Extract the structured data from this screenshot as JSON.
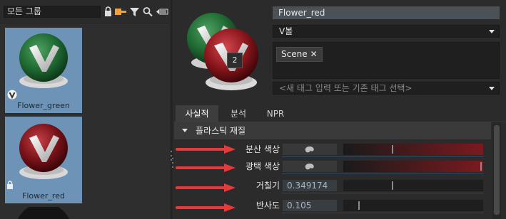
{
  "left": {
    "group_filter": "모든 그룹",
    "toolbar_icons": [
      "lock-icon",
      "tag-icon",
      "filter-icon",
      "search-icon",
      "size-slider-icon"
    ],
    "assets": [
      {
        "name": "Flower_green",
        "selected": true,
        "badge": "vector-icon"
      },
      {
        "name": "Flower_red",
        "selected": true,
        "badge": "lock-icon"
      }
    ]
  },
  "right": {
    "material_name": "Flower_red",
    "shader_select": "V볼",
    "preview_badge": "2",
    "tags": [
      {
        "label": "Scene",
        "remove": "✕"
      }
    ],
    "tag_input_placeholder": "<새 태그 입력 또는 기존 태그 선택>",
    "tabs": [
      {
        "label": "사실적",
        "active": true
      },
      {
        "label": "분석",
        "active": false
      },
      {
        "label": "NPR",
        "active": false
      }
    ],
    "section_title": "플라스틱 재질",
    "properties": {
      "diffuse": {
        "label": "분산 색상",
        "slider_fraction": 0.35
      },
      "gloss": {
        "label": "광택 색상",
        "slider_fraction": 0.99
      },
      "roughness": {
        "label": "거칠기",
        "value": "0.349174",
        "slider_fraction": 0.35
      },
      "reflect": {
        "label": "반사도",
        "value": "0.105",
        "slider_fraction": 0.11
      }
    }
  },
  "colors": {
    "accent_red": "#e53a3a",
    "selection_blue": "#6d93b6",
    "material_red": "#7a1a1f"
  }
}
